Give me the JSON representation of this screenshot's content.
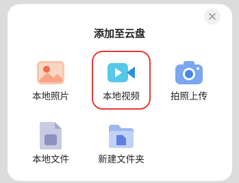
{
  "dialog": {
    "title": "添加至云盘",
    "close_icon": "close-icon"
  },
  "options": [
    {
      "id": "local-photo",
      "label": "本地照片",
      "icon": "photo-icon"
    },
    {
      "id": "local-video",
      "label": "本地视频",
      "icon": "video-camera-icon",
      "highlighted": true,
      "highlight_color": "#e53935"
    },
    {
      "id": "take-photo-upload",
      "label": "拍照上传",
      "icon": "camera-icon"
    },
    {
      "id": "local-file",
      "label": "本地文件",
      "icon": "document-icon"
    },
    {
      "id": "new-folder",
      "label": "新建文件夹",
      "icon": "new-folder-icon"
    }
  ]
}
